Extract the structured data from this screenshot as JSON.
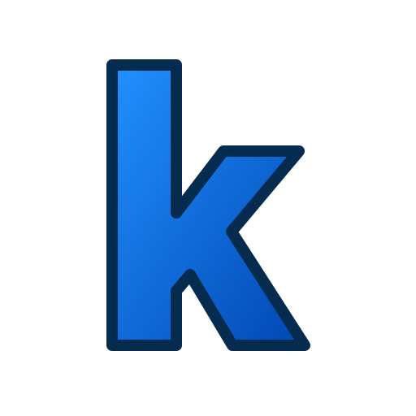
{
  "logo": {
    "letter": "k",
    "icon": "letter-k-icon",
    "colors": {
      "gradient_start": "#2191FF",
      "gradient_end": "#0047B3",
      "outline": "#052B4F",
      "background": "#FFFFFF"
    }
  }
}
